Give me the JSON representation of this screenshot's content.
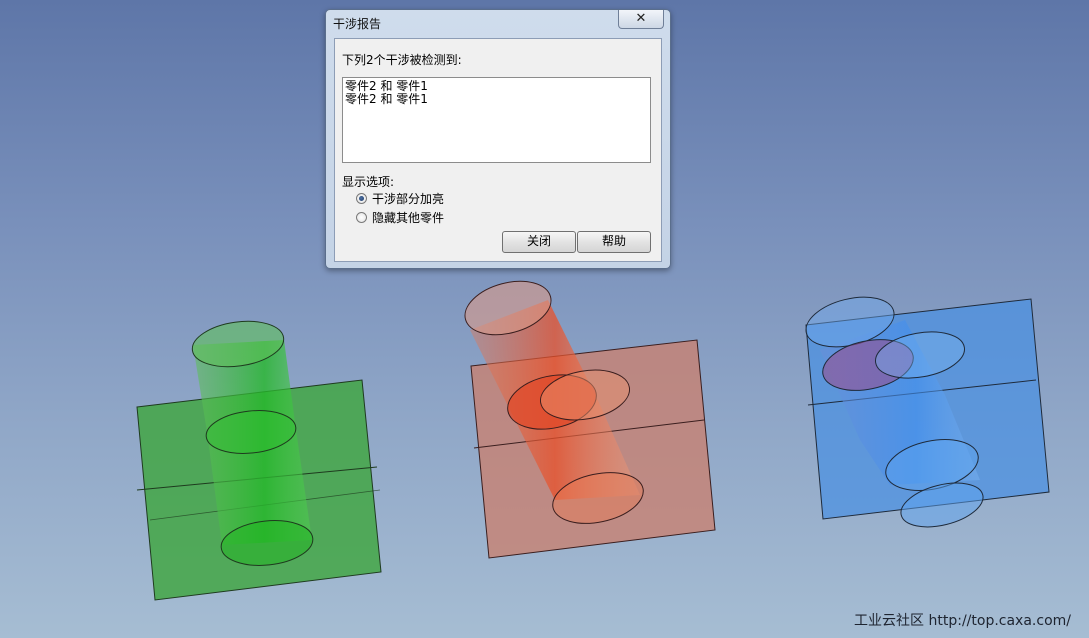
{
  "dialog": {
    "title": "干涉报告",
    "close_glyph": "✕",
    "detect_label": "下列2个干涉被检测到:",
    "interferences": [
      "零件2 和 零件1",
      "零件2 和 零件1"
    ],
    "options_label": "显示选项:",
    "options": [
      {
        "label": "干涉部分加亮",
        "selected": true
      },
      {
        "label": "隐藏其他零件",
        "selected": false
      }
    ],
    "close_button": "关闭",
    "help_button": "帮助"
  },
  "watermark": "工业云社区 http://top.caxa.com/",
  "models": [
    {
      "name": "green-part",
      "color": "#3fa63f"
    },
    {
      "name": "red-part",
      "color": "#c97a6c"
    },
    {
      "name": "blue-part",
      "color": "#4a90e2"
    }
  ]
}
